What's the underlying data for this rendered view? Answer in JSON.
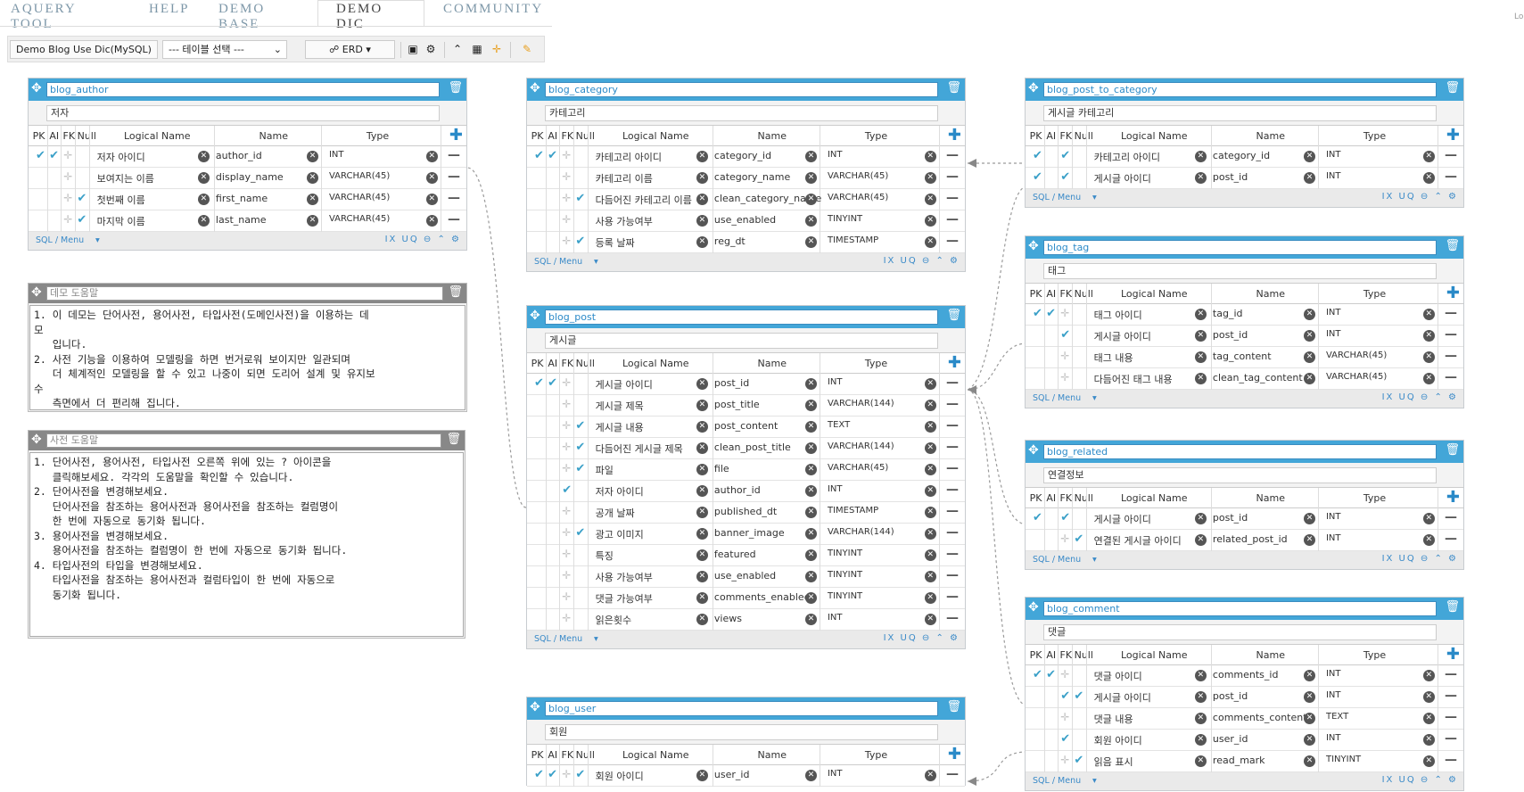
{
  "nav": {
    "tabs": [
      "AQUERY TOOL",
      "HELP",
      "DEMO BASE",
      "DEMO DIC",
      "COMMUNITY"
    ],
    "active": "DEMO DIC",
    "corner": "Lo"
  },
  "toolbar": {
    "db_label": "Demo Blog Use Dic(MySQL)",
    "table_select": "--- 테이블 선택 ---",
    "erd_label": "ERD"
  },
  "header_cols": {
    "pk": "PK",
    "ai": "AI",
    "fk": "FK",
    "nul": "Null",
    "logical": "Logical Name",
    "name": "Name",
    "type": "Type"
  },
  "footer": {
    "sql_menu": "SQL / Menu",
    "icons": "IX UQ ⊖ ⌃ ⚙"
  },
  "notes": [
    {
      "title": "데모 도움말",
      "lines": [
        "1. 이 데모는 단어사전, 용어사전, 타입사전(도메인사전)을 이용하는 데",
        "모",
        "   입니다.",
        "2. 사전 기능을 이용하여 모델링을 하면 번거로워 보이지만 일관되며",
        "   더 체계적인 모델링을 할 수 있고 나중이 되면 도리어 설계 및 유지보",
        "수",
        "   측면에서 더 편리해 집니다."
      ]
    },
    {
      "title": "사전 도움말",
      "lines": [
        "1. 단어사전, 용어사전, 타입사전 오른쪽 위에 있는 ? 아이콘을",
        "   클릭해보세요. 각각의 도움말을 확인할 수 있습니다.",
        "2. 단어사전을 변경해보세요.",
        "   단어사전을 참조하는 용어사전과 용어사전을 참조하는 컬럼명이",
        "   한 번에 자동으로 동기화 됩니다.",
        "3. 용어사전을 변경해보세요.",
        "   용어사전을 참조하는 컬럼명이 한 번에 자동으로 동기화 됩니다.",
        "4. 타입사전의 타입을 변경해보세요.",
        "   타입사전을 참조하는 용어사전과 컬럼타입이 한 번에 자동으로",
        "   동기화 됩니다."
      ]
    }
  ],
  "tables": [
    {
      "name": "blog_author",
      "logical": "저자",
      "rows": [
        {
          "pk": true,
          "ai": true,
          "fk": false,
          "nul": false,
          "logical": "저자 아이디",
          "name": "author_id",
          "type": "INT"
        },
        {
          "pk": false,
          "ai": false,
          "fk": false,
          "nul": false,
          "logical": "보여지는 이름",
          "name": "display_name",
          "type": "VARCHAR(45)"
        },
        {
          "pk": false,
          "ai": false,
          "fk": false,
          "nul": true,
          "logical": "첫번째 이름",
          "name": "first_name",
          "type": "VARCHAR(45)"
        },
        {
          "pk": false,
          "ai": false,
          "fk": false,
          "nul": true,
          "logical": "마지막 이름",
          "name": "last_name",
          "type": "VARCHAR(45)"
        }
      ]
    },
    {
      "name": "blog_category",
      "logical": "카테고리",
      "rows": [
        {
          "pk": true,
          "ai": true,
          "fk": false,
          "nul": false,
          "logical": "카테고리 아이디",
          "name": "category_id",
          "type": "INT"
        },
        {
          "pk": false,
          "ai": false,
          "fk": false,
          "nul": false,
          "logical": "카테고리 이름",
          "name": "category_name",
          "type": "VARCHAR(45)"
        },
        {
          "pk": false,
          "ai": false,
          "fk": false,
          "nul": true,
          "logical": "다듬어진 카테고리 이름",
          "name": "clean_category_name",
          "type": "VARCHAR(45)"
        },
        {
          "pk": false,
          "ai": false,
          "fk": false,
          "nul": false,
          "logical": "사용 가능여부",
          "name": "use_enabled",
          "type": "TINYINT"
        },
        {
          "pk": false,
          "ai": false,
          "fk": false,
          "nul": true,
          "logical": "등록 날짜",
          "name": "reg_dt",
          "type": "TIMESTAMP"
        }
      ]
    },
    {
      "name": "blog_post",
      "logical": "게시글",
      "rows": [
        {
          "pk": true,
          "ai": true,
          "fk": false,
          "nul": false,
          "logical": "게시글 아이디",
          "name": "post_id",
          "type": "INT"
        },
        {
          "pk": false,
          "ai": false,
          "fk": false,
          "nul": false,
          "logical": "게시글 제목",
          "name": "post_title",
          "type": "VARCHAR(144)"
        },
        {
          "pk": false,
          "ai": false,
          "fk": false,
          "nul": true,
          "logical": "게시글 내용",
          "name": "post_content",
          "type": "TEXT"
        },
        {
          "pk": false,
          "ai": false,
          "fk": false,
          "nul": true,
          "logical": "다듬어진 게시글 제목",
          "name": "clean_post_title",
          "type": "VARCHAR(144)"
        },
        {
          "pk": false,
          "ai": false,
          "fk": false,
          "nul": true,
          "logical": "파일",
          "name": "file",
          "type": "VARCHAR(45)"
        },
        {
          "pk": false,
          "ai": false,
          "fk": true,
          "nul": false,
          "logical": "저자 아이디",
          "name": "author_id",
          "type": "INT"
        },
        {
          "pk": false,
          "ai": false,
          "fk": false,
          "nul": false,
          "logical": "공개 날짜",
          "name": "published_dt",
          "type": "TIMESTAMP"
        },
        {
          "pk": false,
          "ai": false,
          "fk": false,
          "nul": true,
          "logical": "광고 이미지",
          "name": "banner_image",
          "type": "VARCHAR(144)"
        },
        {
          "pk": false,
          "ai": false,
          "fk": false,
          "nul": false,
          "logical": "특징",
          "name": "featured",
          "type": "TINYINT"
        },
        {
          "pk": false,
          "ai": false,
          "fk": false,
          "nul": false,
          "logical": "사용 가능여부",
          "name": "use_enabled",
          "type": "TINYINT"
        },
        {
          "pk": false,
          "ai": false,
          "fk": false,
          "nul": false,
          "logical": "댓글 가능여부",
          "name": "comments_enabled",
          "type": "TINYINT"
        },
        {
          "pk": false,
          "ai": false,
          "fk": false,
          "nul": false,
          "logical": "읽은횟수",
          "name": "views",
          "type": "INT"
        }
      ]
    },
    {
      "name": "blog_user",
      "logical": "회원",
      "rows": [
        {
          "pk": true,
          "ai": true,
          "fk": false,
          "nul": true,
          "logical": "회원 아이디",
          "name": "user_id",
          "type": "INT"
        }
      ]
    },
    {
      "name": "blog_post_to_category",
      "logical": "게시글 카테고리",
      "rows": [
        {
          "pk": true,
          "ai": false,
          "fk": true,
          "nul": false,
          "logical": "카테고리 아이디",
          "name": "category_id",
          "type": "INT"
        },
        {
          "pk": true,
          "ai": false,
          "fk": true,
          "nul": false,
          "logical": "게시글 아이디",
          "name": "post_id",
          "type": "INT"
        }
      ]
    },
    {
      "name": "blog_tag",
      "logical": "태그",
      "rows": [
        {
          "pk": true,
          "ai": true,
          "fk": false,
          "nul": false,
          "logical": "태그 아이디",
          "name": "tag_id",
          "type": "INT"
        },
        {
          "pk": false,
          "ai": false,
          "fk": true,
          "nul": false,
          "logical": "게시글 아이디",
          "name": "post_id",
          "type": "INT"
        },
        {
          "pk": false,
          "ai": false,
          "fk": false,
          "nul": false,
          "logical": "태그 내용",
          "name": "tag_content",
          "type": "VARCHAR(45)"
        },
        {
          "pk": false,
          "ai": false,
          "fk": false,
          "nul": false,
          "logical": "다듬어진 태그 내용",
          "name": "clean_tag_content",
          "type": "VARCHAR(45)"
        }
      ]
    },
    {
      "name": "blog_related",
      "logical": "연결정보",
      "rows": [
        {
          "pk": true,
          "ai": false,
          "fk": true,
          "nul": false,
          "logical": "게시글 아이디",
          "name": "post_id",
          "type": "INT"
        },
        {
          "pk": false,
          "ai": false,
          "fk": false,
          "nul": true,
          "logical": "연결된 게시글 아이디",
          "name": "related_post_id",
          "type": "INT"
        }
      ]
    },
    {
      "name": "blog_comment",
      "logical": "댓글",
      "rows": [
        {
          "pk": true,
          "ai": true,
          "fk": false,
          "nul": false,
          "logical": "댓글 아이디",
          "name": "comments_id",
          "type": "INT"
        },
        {
          "pk": false,
          "ai": false,
          "fk": true,
          "nul": true,
          "logical": "게시글 아이디",
          "name": "post_id",
          "type": "INT"
        },
        {
          "pk": false,
          "ai": false,
          "fk": false,
          "nul": false,
          "logical": "댓글 내용",
          "name": "comments_content",
          "type": "TEXT"
        },
        {
          "pk": false,
          "ai": false,
          "fk": true,
          "nul": false,
          "logical": "회원 아이디",
          "name": "user_id",
          "type": "INT"
        },
        {
          "pk": false,
          "ai": false,
          "fk": false,
          "nul": true,
          "logical": "읽음 표시",
          "name": "read_mark",
          "type": "TINYINT"
        }
      ]
    }
  ]
}
